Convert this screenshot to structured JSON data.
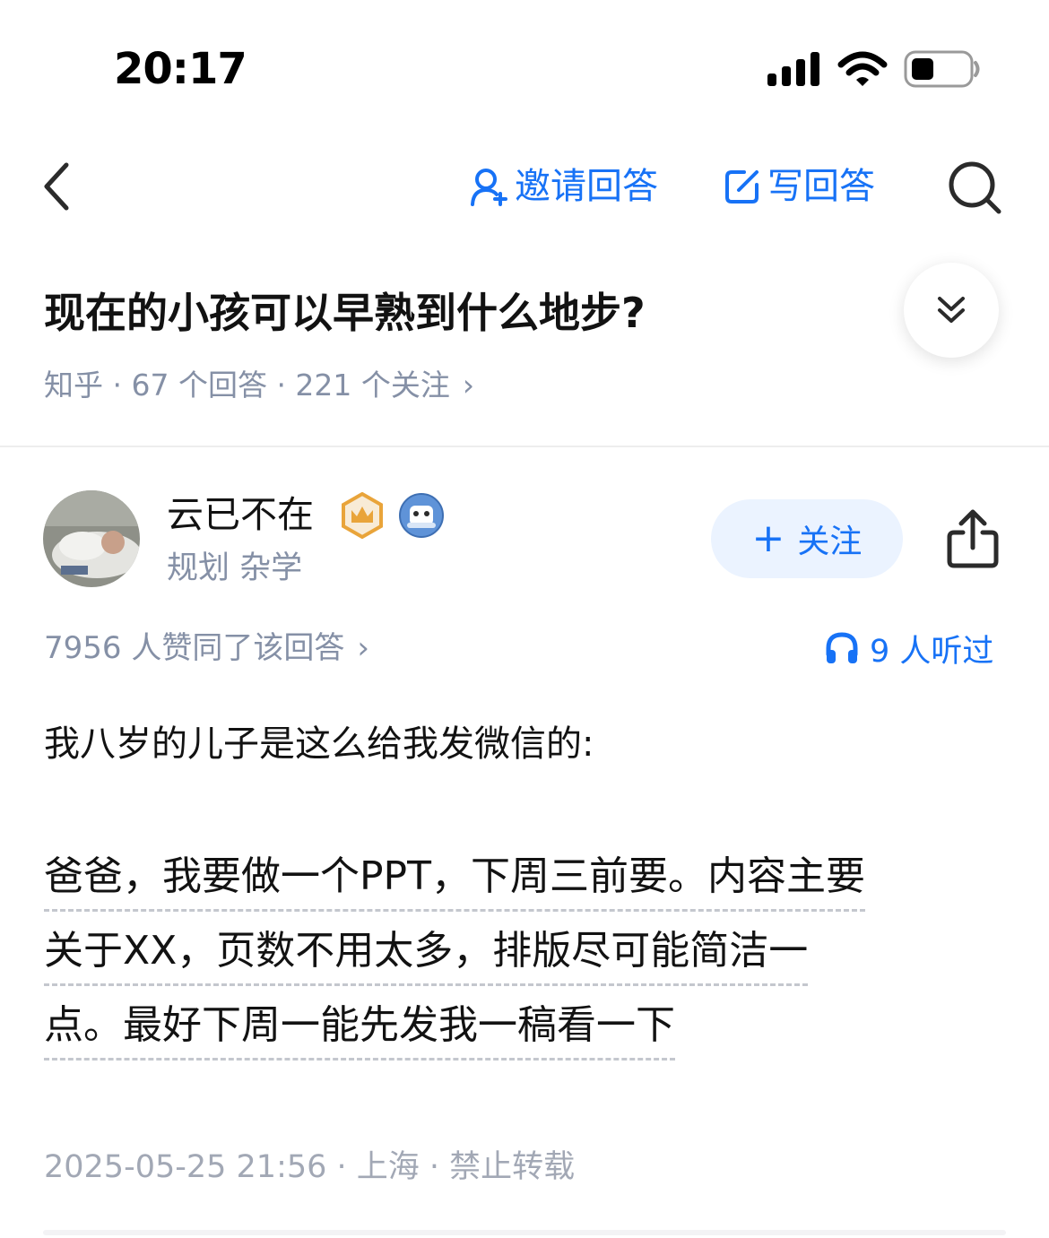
{
  "status_bar": {
    "time": "20:17"
  },
  "nav": {
    "invite_label": "邀请回答",
    "write_label": "写回答"
  },
  "question": {
    "title": "现在的小孩可以早熟到什么地步?",
    "meta": "知乎 · 67 个回答 · 221 个关注",
    "meta_chevron": "›"
  },
  "author": {
    "name": "云已不在",
    "tagline": "规划 杂学",
    "follow_label": "关注",
    "follow_plus": "+"
  },
  "answer": {
    "likes": "7956 人赞同了该回答",
    "likes_chevron": "›",
    "listeners": "9 人听过",
    "paragraph1": "我八岁的儿子是这么给我发微信的:",
    "paragraph2_lines": [
      "爸爸，我要做一个PPT，下周三前要。内容主要",
      "关于XX，页数不用太多，排版尽可能简洁一",
      "点。最好下周一能先发我一稿看一下"
    ],
    "footer": "2025-05-25 21:56 · 上海 · 禁止转载"
  },
  "colors": {
    "accent": "#1772F6",
    "meta_gray": "#8590A6",
    "badge_gold": "#E9A43A"
  },
  "icons": [
    "signal-icon",
    "wifi-icon",
    "battery-icon",
    "back-arrow-icon",
    "invite-user-icon",
    "edit-icon",
    "search-icon",
    "collapse-chevrons-icon",
    "crown-badge-icon",
    "mascot-badge-icon",
    "plus-icon",
    "share-icon",
    "headphones-icon"
  ]
}
